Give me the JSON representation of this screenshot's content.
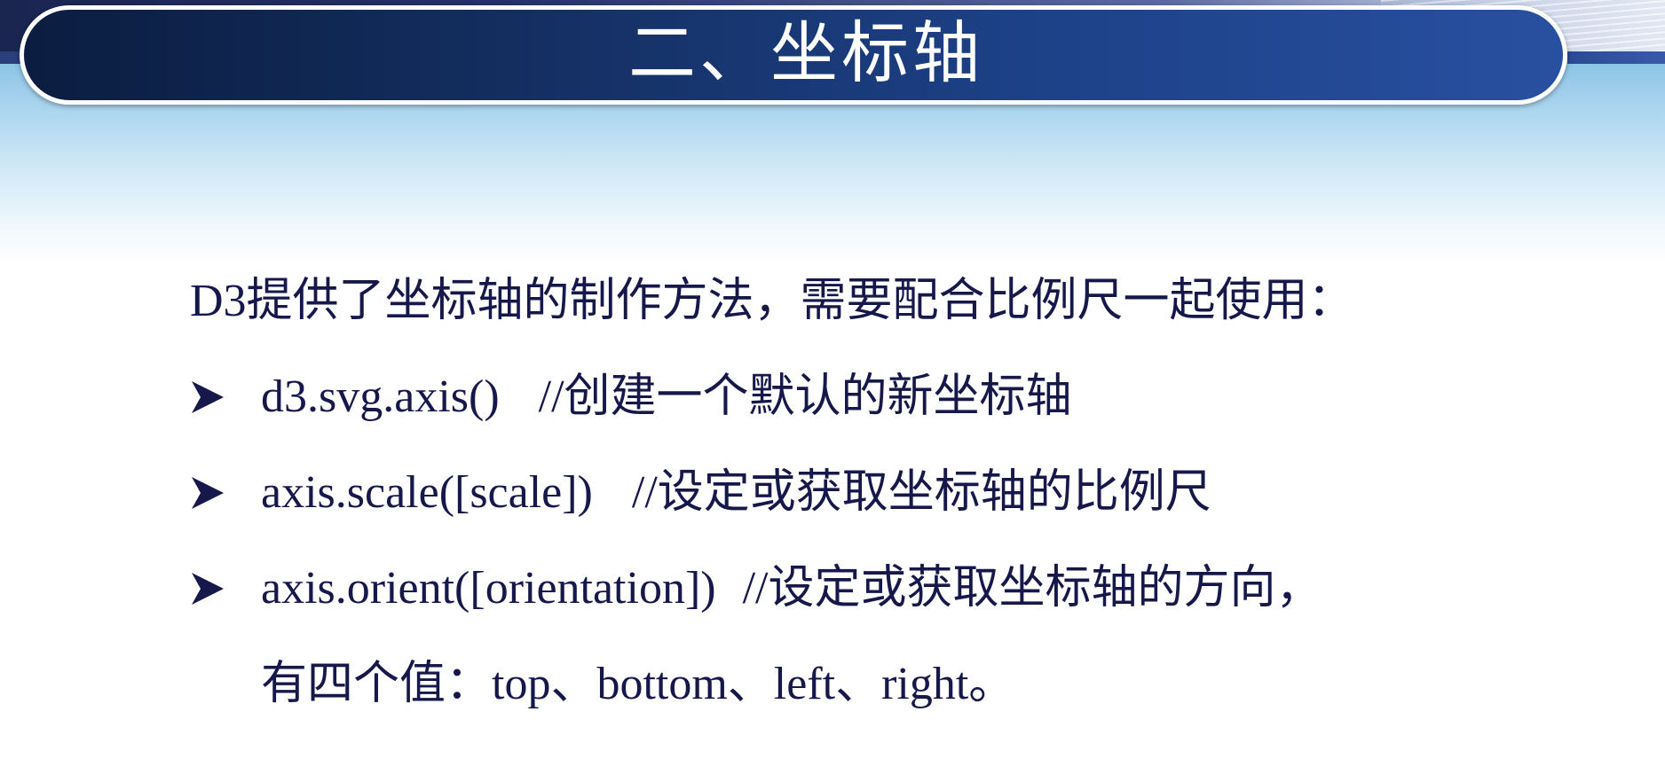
{
  "slide": {
    "title": "二、坐标轴",
    "intro": "D3提供了坐标轴的制作方法，需要配合比例尺一起使用：",
    "bullets": [
      {
        "icon": "arrowhead-bullet-icon",
        "code": "d3.svg.axis()",
        "comment": "//创建一个默认的新坐标轴"
      },
      {
        "icon": "arrowhead-bullet-icon",
        "code": "axis.scale([scale])",
        "comment": "//设定或获取坐标轴的比例尺"
      },
      {
        "icon": "arrowhead-bullet-icon",
        "code": "axis.orient([orientation])",
        "comment": "//设定或获取坐标轴的方向，"
      }
    ],
    "continuation": "有四个值：top、bottom、left、right。"
  },
  "colors": {
    "title_bar": "#1d4187",
    "text": "#16174a",
    "sky": "#86c1e3"
  }
}
